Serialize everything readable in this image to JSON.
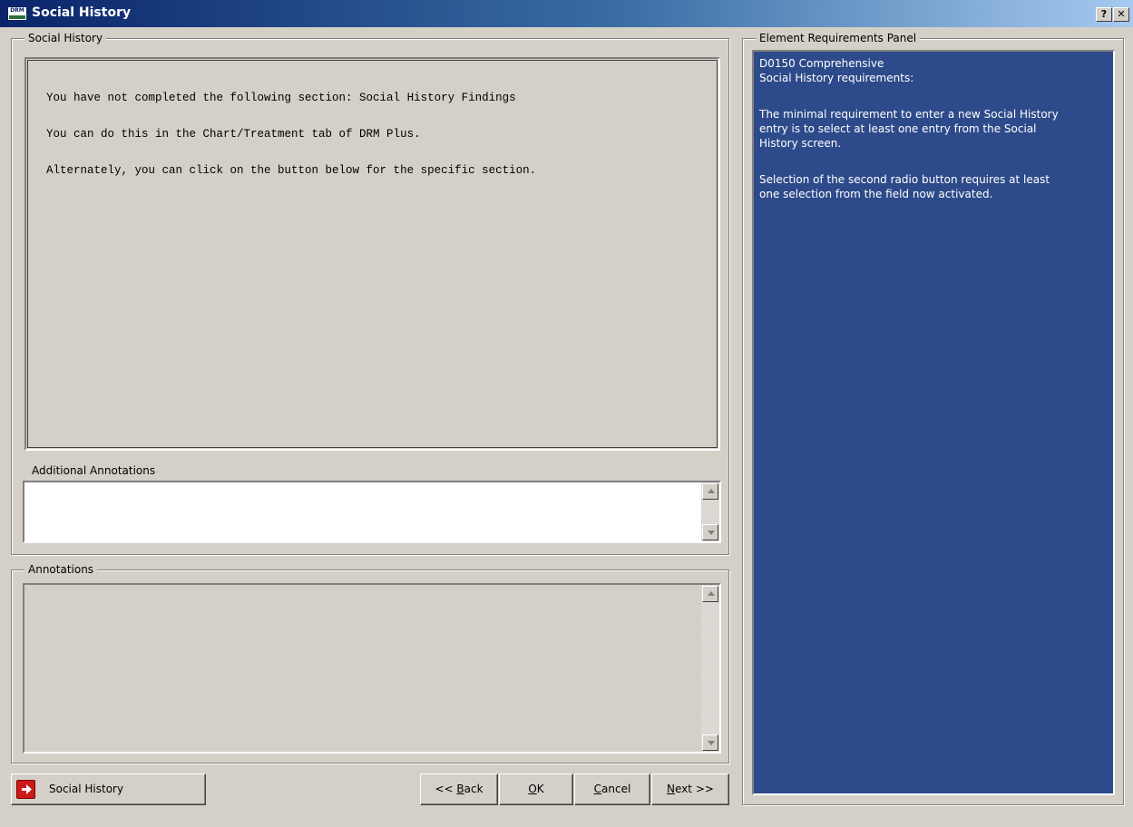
{
  "window": {
    "title": "Social History",
    "app_icon_text": "DRM",
    "help_label": "?",
    "close_label": "✕"
  },
  "social_history_group": {
    "legend": "Social History",
    "message_lines": [
      "You have not completed the following section:  Social History Findings",
      "You can do this in the Chart/Treatment tab of DRM Plus.",
      "Alternately, you can click on the button below for the specific section."
    ],
    "additional_annotations_label": "Additional Annotations",
    "additional_annotations_value": ""
  },
  "annotations_group": {
    "legend": "Annotations",
    "value": ""
  },
  "requirements_panel": {
    "legend": "Element Requirements Panel",
    "lines": [
      "D0150  Comprehensive",
      "Social History requirements:",
      "",
      "The minimal requirement to enter a new Social History",
      "entry is to select at least one entry from the Social",
      "History screen.",
      "",
      "Selection of the second radio button requires at least",
      "one selection from the field now activated."
    ]
  },
  "buttons": {
    "social_history": "Social History",
    "back_prefix": "<< ",
    "back_key": "B",
    "back_rest": "ack",
    "ok_key": "O",
    "ok_rest": "K",
    "cancel_key": "C",
    "cancel_rest": "ancel",
    "next_key": "N",
    "next_rest": "ext >>"
  }
}
